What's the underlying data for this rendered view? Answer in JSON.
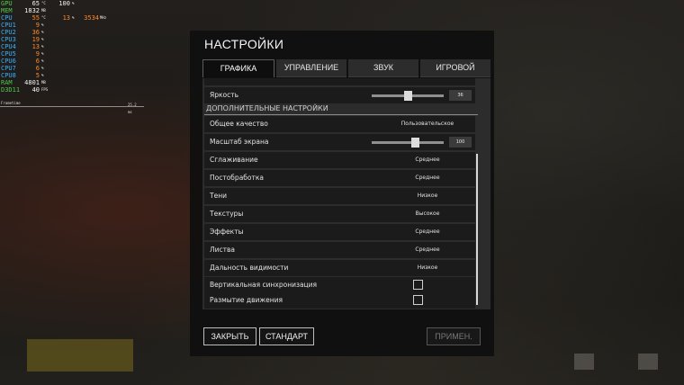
{
  "overlay": {
    "rows": [
      {
        "label": "GPU",
        "label_color": "#4dc84d",
        "value": "65",
        "unit": "°C",
        "value2": "100",
        "unit2": "%"
      },
      {
        "label": "MEM",
        "label_color": "#4dc84d",
        "value": "1832",
        "unit": "MB",
        "value2": "",
        "unit2": ""
      },
      {
        "label": "CPU",
        "label_color": "#3ab0ff",
        "value": "55",
        "unit": "°C",
        "value2": "13",
        "unit2": "%",
        "value3": "3534",
        "unit3": "MHz"
      },
      {
        "label": "CPU1",
        "label_color": "#3ab0ff",
        "value": "9",
        "unit": "%"
      },
      {
        "label": "CPU2",
        "label_color": "#3ab0ff",
        "value": "36",
        "unit": "%"
      },
      {
        "label": "CPU3",
        "label_color": "#3ab0ff",
        "value": "19",
        "unit": "%"
      },
      {
        "label": "CPU4",
        "label_color": "#3ab0ff",
        "value": "13",
        "unit": "%"
      },
      {
        "label": "CPU5",
        "label_color": "#3ab0ff",
        "value": "9",
        "unit": "%"
      },
      {
        "label": "CPU6",
        "label_color": "#3ab0ff",
        "value": "6",
        "unit": "%"
      },
      {
        "label": "CPU7",
        "label_color": "#3ab0ff",
        "value": "6",
        "unit": "%"
      },
      {
        "label": "CPU8",
        "label_color": "#3ab0ff",
        "value": "5",
        "unit": "%"
      },
      {
        "label": "RAM",
        "label_color": "#4dc84d",
        "value": "4801",
        "unit": "MB"
      },
      {
        "label": "D3D11",
        "label_color": "#4dc84d",
        "value": "40",
        "unit": "FPS"
      }
    ],
    "frametime_label": "Frametime",
    "frametime_ms": "25.2 ms",
    "value_color": "#f5f5f5",
    "cpu_value_color": "#ff8a2a"
  },
  "dialog": {
    "title": "НАСТРОЙКИ",
    "tabs": [
      {
        "label": "ГРАФИКА",
        "active": true
      },
      {
        "label": "УПРАВЛЕНИЕ",
        "active": false
      },
      {
        "label": "ЗВУК",
        "active": false
      },
      {
        "label": "ИГРОВОЙ ПРОЦЕСС",
        "active": false
      }
    ],
    "brightness": {
      "label": "Яркость",
      "value": "36",
      "fraction": 0.5
    },
    "section_title": "ДОПОЛНИТЕЛЬНЫЕ НАСТРОЙКИ",
    "overall_quality": {
      "label": "Общее качество",
      "value": "Пользовательское"
    },
    "screen_scale": {
      "label": "Масштаб экрана",
      "value": "100",
      "fraction": 0.6
    },
    "settings": [
      {
        "label": "Сглаживание",
        "value": "Среднее"
      },
      {
        "label": "Постобработка",
        "value": "Среднее"
      },
      {
        "label": "Тени",
        "value": "Низкое"
      },
      {
        "label": "Текстуры",
        "value": "Высокое"
      },
      {
        "label": "Эффекты",
        "value": "Среднее"
      },
      {
        "label": "Листва",
        "value": "Среднее"
      },
      {
        "label": "Дальность видимости",
        "value": "Низкое"
      }
    ],
    "checkboxes": [
      {
        "label": "Вертикальная синхронизация",
        "checked": false
      },
      {
        "label": "Размытие движения",
        "checked": false
      }
    ],
    "buttons": {
      "close": "ЗАКРЫТЬ",
      "default": "СТАНДАРТ",
      "apply": "ПРИМЕН."
    }
  }
}
